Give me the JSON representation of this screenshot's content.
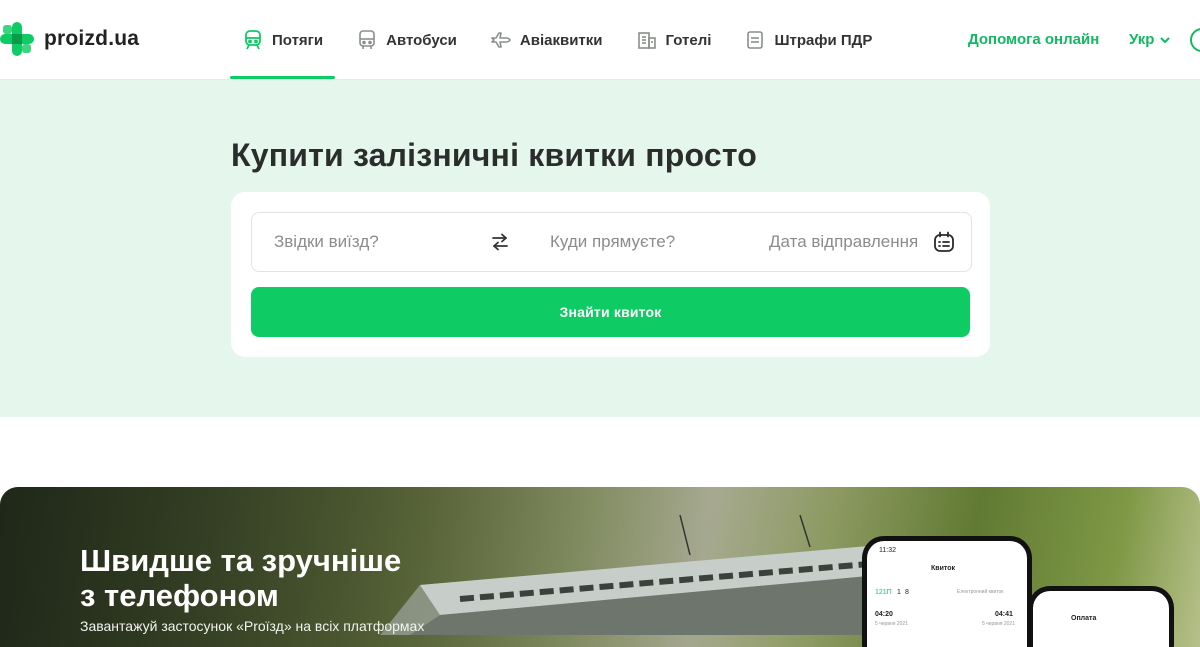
{
  "header": {
    "logo_text": "proizd.ua",
    "nav": [
      {
        "label": "Потяги",
        "icon": "train-icon",
        "active": true
      },
      {
        "label": "Автобуси",
        "icon": "bus-icon",
        "active": false
      },
      {
        "label": "Авіаквитки",
        "icon": "plane-icon",
        "active": false
      },
      {
        "label": "Готелі",
        "icon": "hotel-icon",
        "active": false
      },
      {
        "label": "Штрафи ПДР",
        "icon": "document-icon",
        "active": false
      }
    ],
    "help_label": "Допомога онлайн",
    "lang_label": "Укр"
  },
  "hero": {
    "title": "Купити залізничні квитки просто",
    "search": {
      "from_placeholder": "Звідки виїзд?",
      "to_placeholder": "Куди прямуєте?",
      "date_placeholder": "Дата відправлення",
      "submit_label": "Знайти квиток"
    }
  },
  "promo": {
    "title_line1": "Швидше та зручніше",
    "title_line2": "з телефоном",
    "subtitle": "Завантажуй застосунок «Proїзд» на всіх платформах",
    "phone1": {
      "time": "11:32",
      "screen_title": "Квиток",
      "train_no": "121П",
      "car": "1",
      "seat": "8",
      "ticket_type": "Електронний квиток",
      "dep_time": "04:20",
      "dep_date": "5 червня 2021",
      "arr_time": "04:41",
      "arr_date": "5 червня 2021"
    },
    "phone2": {
      "screen_title": "Оплата"
    }
  },
  "colors": {
    "brand_green": "#0ecb63",
    "link_green": "#12b862",
    "hero_bg": "#e5f7ec"
  }
}
